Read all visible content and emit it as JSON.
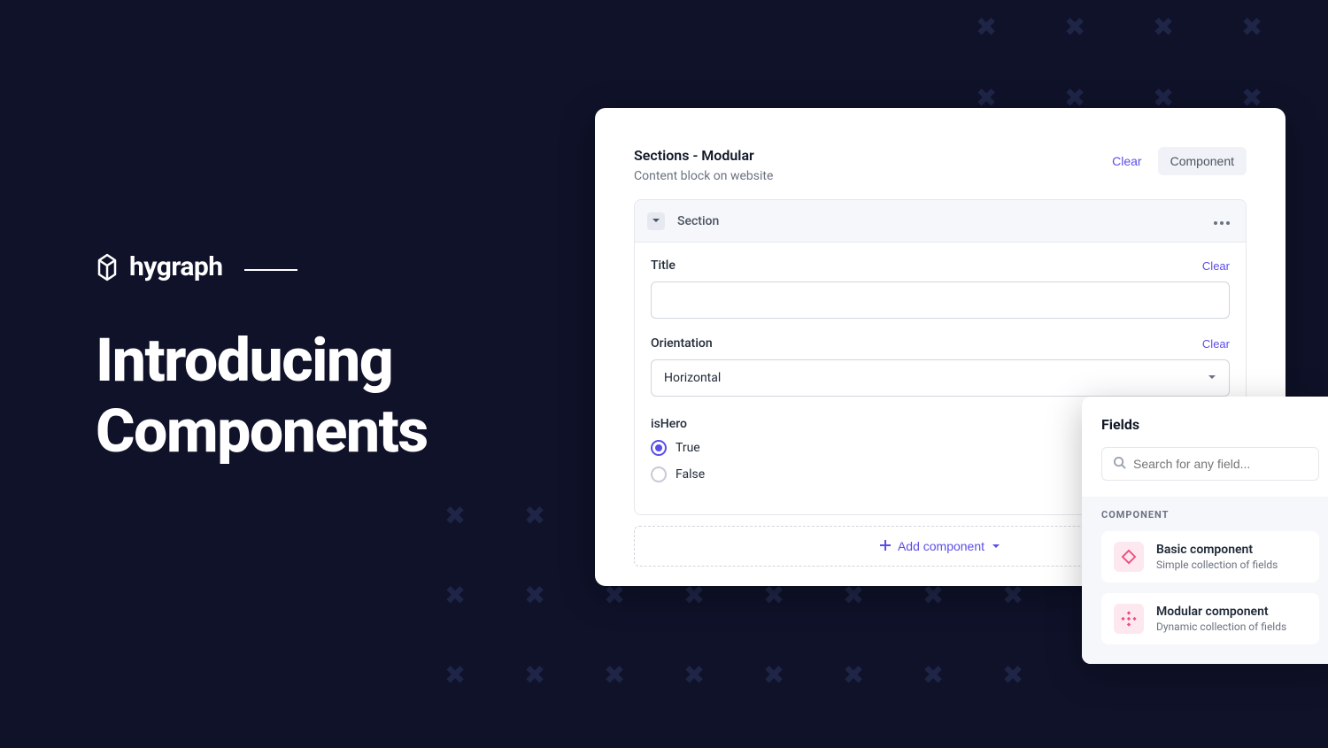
{
  "brand": {
    "name": "hygraph"
  },
  "headline": {
    "line1": "Introducing",
    "line2": "Components"
  },
  "card": {
    "title": "Sections - Modular",
    "subtitle": "Content block on website",
    "actions": {
      "clear": "Clear",
      "component": "Component"
    },
    "section": {
      "name": "Section",
      "fields": {
        "title": {
          "label": "Title",
          "clear": "Clear",
          "value": ""
        },
        "orientation": {
          "label": "Orientation",
          "clear": "Clear",
          "value": "Horizontal"
        },
        "isHero": {
          "label": "isHero",
          "options": {
            "true": "True",
            "false": "False"
          },
          "selected": "true"
        }
      }
    },
    "addComponent": "Add component"
  },
  "popover": {
    "title": "Fields",
    "searchPlaceholder": "Search for any field...",
    "sectionLabel": "COMPONENT",
    "items": [
      {
        "title": "Basic component",
        "subtitle": "Simple collection of fields"
      },
      {
        "title": "Modular component",
        "subtitle": "Dynamic collection of fields"
      }
    ]
  }
}
